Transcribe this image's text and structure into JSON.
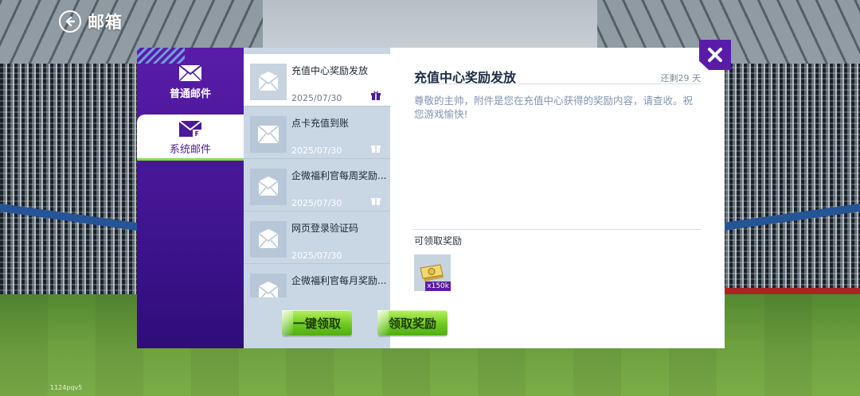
{
  "header": {
    "title": "邮箱"
  },
  "build_tag": "1124pqv5",
  "sidebar": {
    "categories": [
      {
        "label": "普通邮件",
        "icon": "mail-icon",
        "active": false
      },
      {
        "label": "系统邮件",
        "icon": "system-mail-icon",
        "active": true
      }
    ]
  },
  "mail_list": {
    "items": [
      {
        "subject": "充值中心奖励发放",
        "date": "2025/07/30",
        "has_gift": true,
        "selected": true
      },
      {
        "subject": "点卡充值到账",
        "date": "2025/07/30",
        "has_gift": true,
        "selected": false
      },
      {
        "subject": "企微福利官每周奖励...",
        "date": "2025/07/30",
        "has_gift": true,
        "selected": false
      },
      {
        "subject": "网页登录验证码",
        "date": "2025/07/30",
        "has_gift": false,
        "selected": false
      },
      {
        "subject": "企微福利官每月奖励...",
        "date": "",
        "has_gift": false,
        "selected": false
      }
    ],
    "claim_all_label": "一键领取"
  },
  "detail": {
    "subject": "充值中心奖励发放",
    "remaining": "还剩29 天",
    "body": "尊敬的主帅，附件是您在充值中心获得的奖励内容，请查收。祝您游戏愉快!",
    "rewards_title": "可领取奖励",
    "rewards": [
      {
        "icon": "coin-ticket-icon",
        "quantity": "x150k"
      }
    ],
    "claim_label": "领取奖励"
  },
  "colors": {
    "sidebar_purple": "#5a1ca8",
    "list_bg": "#c9d6e4",
    "accent_green": "#7ee04a"
  }
}
